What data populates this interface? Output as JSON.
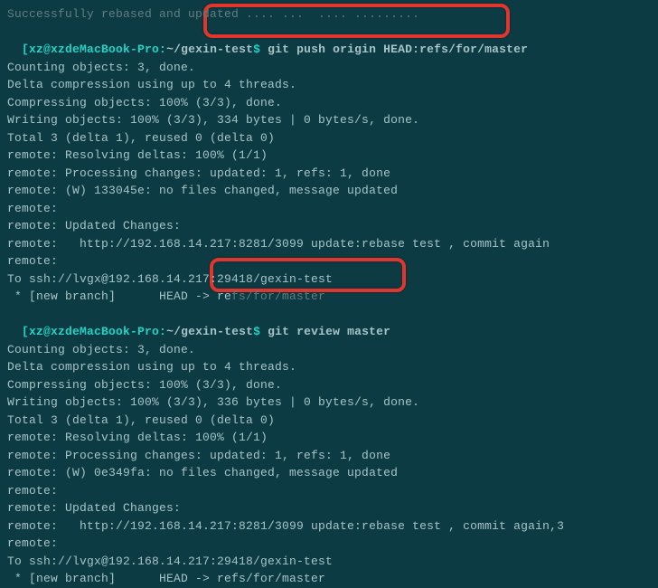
{
  "prompt1": {
    "userhost": "xz@xzdeMacBook-Pro:",
    "path": "~/gexin-test",
    "command": "git push origin HEAD:refs/for/master"
  },
  "prompt2": {
    "userhost": "xz@xzdeMacBook-Pro:",
    "path": "~/gexin-test",
    "command": "git review master"
  },
  "faded_top": "Successfully rebased and updated .... ...  .... .........",
  "block1": {
    "l0": "Counting objects: 3, done.",
    "l1": "Delta compression using up to 4 threads.",
    "l2": "Compressing objects: 100% (3/3), done.",
    "l3": "Writing objects: 100% (3/3), 334 bytes | 0 bytes/s, done.",
    "l4": "Total 3 (delta 1), reused 0 (delta 0)",
    "l5": "remote: Resolving deltas: 100% (1/1)",
    "l6": "remote: Processing changes: updated: 1, refs: 1, done",
    "l7": "remote: (W) 133045e: no files changed, message updated",
    "l8": "remote:",
    "l9": "remote: Updated Changes:",
    "l10": "remote:   http://192.168.14.217:8281/3099 update:rebase test , commit again",
    "l11": "remote:",
    "l12": "To ssh://lvgx@192.168.14.217:29418/gexin-test",
    "l13_a": " * [new branch]      HEAD -> re",
    "l13_b": "fs/for/master"
  },
  "block2": {
    "l0": "Counting objects: 3, done.",
    "l1": "Delta compression using up to 4 threads.",
    "l2": "Compressing objects: 100% (3/3), done.",
    "l3": "Writing objects: 100% (3/3), 336 bytes | 0 bytes/s, done.",
    "l4": "Total 3 (delta 1), reused 0 (delta 0)",
    "l5": "remote: Resolving deltas: 100% (1/1)",
    "l6": "remote: Processing changes: updated: 1, refs: 1, done",
    "l7": "remote: (W) 0e349fa: no files changed, message updated",
    "l8": "remote:",
    "l9": "remote: Updated Changes:",
    "l10": "remote:   http://192.168.14.217:8281/3099 update:rebase test , commit again,3",
    "l11": "remote:",
    "l12": "To ssh://lvgx@192.168.14.217:29418/gexin-test",
    "l13": " * [new branch]      HEAD -> refs/for/master"
  }
}
